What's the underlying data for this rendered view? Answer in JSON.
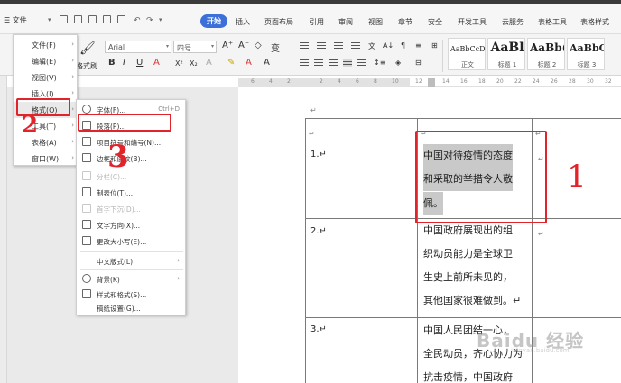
{
  "toolbar": {
    "menu_label": "☰ 文件",
    "tabs": [
      "开始",
      "插入",
      "页面布局",
      "引用",
      "审阅",
      "视图",
      "章节",
      "安全",
      "开发工具",
      "云服务",
      "表格工具",
      "表格样式"
    ],
    "font_name": "Arial",
    "font_size": "四号",
    "paste_label": "格式刷",
    "bold": "B",
    "italic": "I",
    "underline": "U",
    "grow": "A⁺",
    "shrink": "A⁻",
    "sup": "X²",
    "sub": "X₂"
  },
  "styles": [
    {
      "sample": "AaBbCcDd",
      "name": "正文"
    },
    {
      "sample": "AaBl",
      "name": "标题 1"
    },
    {
      "sample": "AaBb(",
      "name": "标题 2"
    },
    {
      "sample": "AaBbC",
      "name": "标题 3"
    }
  ],
  "ruler": {
    "numbers": [
      "6",
      "4",
      "2",
      "2",
      "4",
      "6",
      "8",
      "10",
      "12",
      "14",
      "16",
      "18",
      "20",
      "22",
      "24",
      "26",
      "28",
      "30",
      "32"
    ]
  },
  "file_menu": {
    "items": [
      {
        "label": "文件(F)"
      },
      {
        "label": "编辑(E)"
      },
      {
        "label": "视图(V)"
      },
      {
        "label": "插入(I)"
      },
      {
        "label": "格式(O)"
      },
      {
        "label": "工具(T)"
      },
      {
        "label": "表格(A)"
      },
      {
        "label": "窗口(W)"
      }
    ]
  },
  "format_menu": {
    "items": [
      {
        "label": "字体(F)...",
        "shortcut": "Ctrl+D"
      },
      {
        "label": "段落(P)...",
        "shortcut": ""
      },
      {
        "label": "项目符号和编号(N)...",
        "shortcut": ""
      },
      {
        "label": "边框和底纹(B)...",
        "shortcut": ""
      },
      {
        "label": "分栏(C)...",
        "shortcut": ""
      },
      {
        "label": "制表位(T)...",
        "shortcut": ""
      },
      {
        "label": "首字下沉(D)...",
        "shortcut": ""
      },
      {
        "label": "文字方向(X)...",
        "shortcut": ""
      },
      {
        "label": "更改大小写(E)...",
        "shortcut": ""
      },
      {
        "label": "中文版式(L)",
        "shortcut": ""
      },
      {
        "label": "背景(K)",
        "shortcut": ""
      },
      {
        "label": "样式和格式(S)...",
        "shortcut": ""
      },
      {
        "label": "稿纸设置(G)...",
        "shortcut": ""
      }
    ]
  },
  "table": {
    "row1_num": "1.↵",
    "row2_num": "2.↵",
    "row3_num": "3.↵",
    "row1_lines": [
      "中国对待疫情的态度",
      "和采取的举措令人敬",
      "佩。"
    ],
    "row2_lines": [
      "中国政府展现出的组",
      "织动员能力是全球卫",
      "生史上前所未见的，",
      "其他国家很难做到。↵"
    ],
    "row3_lines": [
      "中国人民团结一心，",
      "全民动员，齐心协力为",
      "抗击疫情，中国政府"
    ],
    "para_mark": "↵"
  },
  "annotations": {
    "step1": "1",
    "step2": "2",
    "step3": "3"
  },
  "watermark": {
    "text": "Baidu 经验",
    "sub": "jingyan.baidu.com"
  },
  "colors": {
    "accent": "#3d6fd8",
    "annotation": "#e0242a"
  }
}
